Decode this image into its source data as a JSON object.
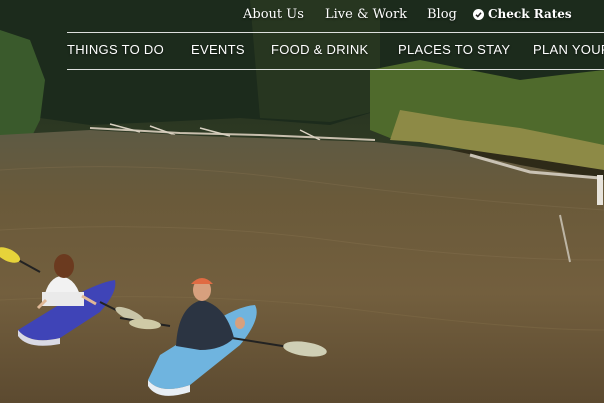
{
  "top_nav": {
    "about": "About Us",
    "live_work": "Live & Work",
    "blog": "Blog",
    "check_rates": "Check Rates"
  },
  "main_nav": {
    "things_to_do": "THINGS TO DO",
    "events": "EVENTS",
    "food_drink": "FOOD & DRINK",
    "places_to_stay": "PLACES TO STAY",
    "plan_your": "PLAN YOUR"
  },
  "hero": {
    "scene": "kayakers on river"
  },
  "colors": {
    "nav_text": "#ffffff",
    "water": "#6a5a3c",
    "forest": "#1f3320",
    "kayak_purple": "#3e43b8",
    "kayak_blue": "#6fb4df",
    "paddle_yellow": "#e3d33a"
  },
  "icons": {
    "check_rates": "check-circle-icon"
  }
}
